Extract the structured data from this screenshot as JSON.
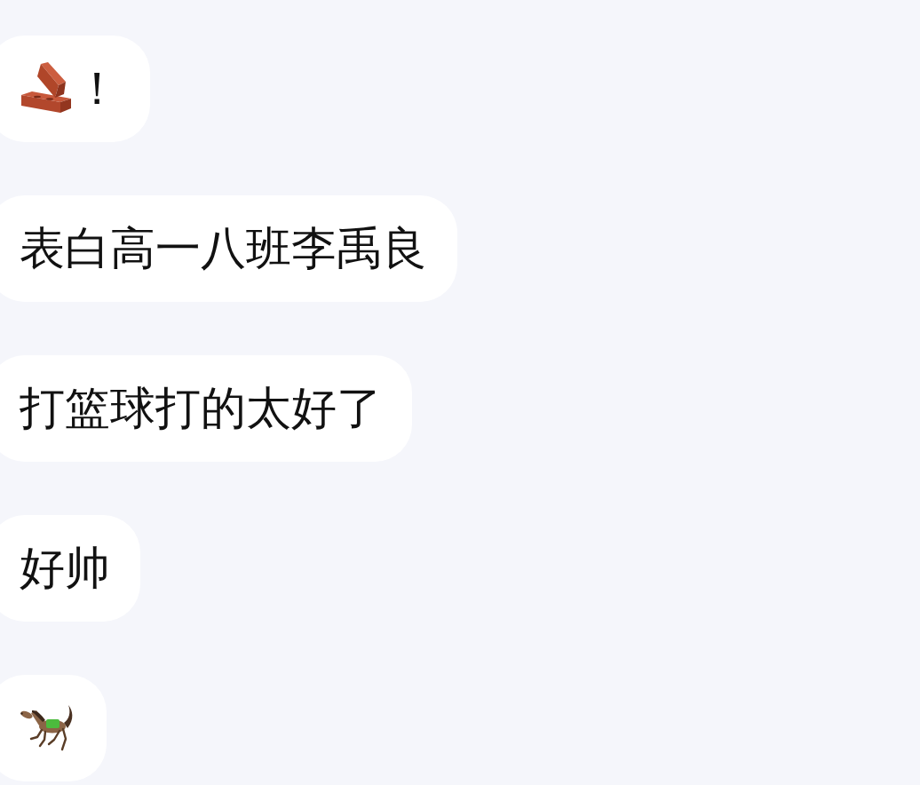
{
  "messages": [
    {
      "kind": "brick",
      "text": "！"
    },
    {
      "kind": "text",
      "text": "表白高一八班李禹良"
    },
    {
      "kind": "text",
      "text": "打篮球打的太好了"
    },
    {
      "kind": "text",
      "text": "好帅"
    },
    {
      "kind": "horse"
    }
  ]
}
